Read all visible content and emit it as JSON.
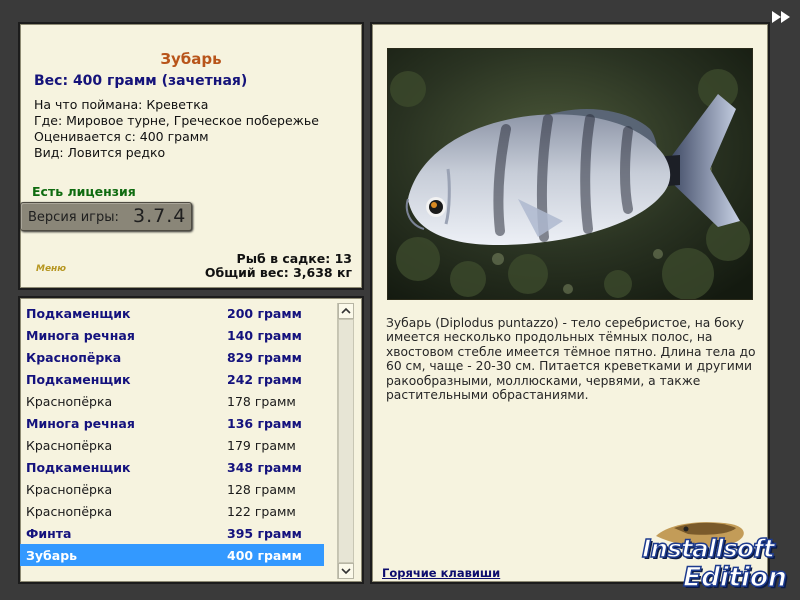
{
  "info": {
    "fish_name": "Зубарь",
    "weight_line": "Вес: 400 грамм (зачетная)",
    "caught_on": "На что поймана: Креветка",
    "location": "Где: Мировое турне, Греческое побережье",
    "valued_from": "Оценивается с: 400 грамм",
    "rarity": "Вид: Ловится редко",
    "license": "Есть лицензия",
    "version_label": "Версия игры:",
    "version_number": "3.7.4",
    "menu_label": "Меню",
    "fish_count": "Рыб в садке: 13",
    "total_weight": "Общий вес: 3,638 кг"
  },
  "catch_list": [
    {
      "name": "Подкаменщик",
      "weight": "200 грамм",
      "rare": true
    },
    {
      "name": "Минога речная",
      "weight": "140 грамм",
      "rare": true
    },
    {
      "name": "Краснопёрка",
      "weight": "829 грамм",
      "rare": true
    },
    {
      "name": "Подкаменщик",
      "weight": "242 грамм",
      "rare": true
    },
    {
      "name": "Краснопёрка",
      "weight": "178 грамм",
      "rare": false
    },
    {
      "name": "Минога речная",
      "weight": "136 грамм",
      "rare": true
    },
    {
      "name": "Краснопёрка",
      "weight": "179 грамм",
      "rare": false
    },
    {
      "name": "Подкаменщик",
      "weight": "348 грамм",
      "rare": true
    },
    {
      "name": "Краснопёрка",
      "weight": "128 грамм",
      "rare": false
    },
    {
      "name": "Краснопёрка",
      "weight": "122 грамм",
      "rare": false
    },
    {
      "name": "Финта",
      "weight": "395 грамм",
      "rare": true
    },
    {
      "name": "Зубарь",
      "weight": "400 грамм",
      "rare": true,
      "selected": true
    }
  ],
  "description": {
    "text": "Зубарь (Diplodus puntazzo) - тело серебристое, на боку имеется несколько продольных тёмных полос, на хвостовом стебле имеется тёмное пятно. Длина тела до 60 см, чаще - 20-30 см. Питается креветками и другими ракообразными, моллюсками, червями, а также растительными обрастаниями.",
    "hotkeys_link": "Горячие клавиши"
  },
  "brand": {
    "line1": "Installsoft",
    "line2": "Edition"
  },
  "icons": {
    "skip": "fast-forward-icon",
    "scroll_up": "chevron-up-icon",
    "scroll_down": "chevron-down-icon"
  },
  "colors": {
    "title": "#b8541a",
    "rare_text": "#14127d",
    "license": "#0f6b10",
    "selection": "#3399ff",
    "panel_bg": "#f6f3df"
  }
}
